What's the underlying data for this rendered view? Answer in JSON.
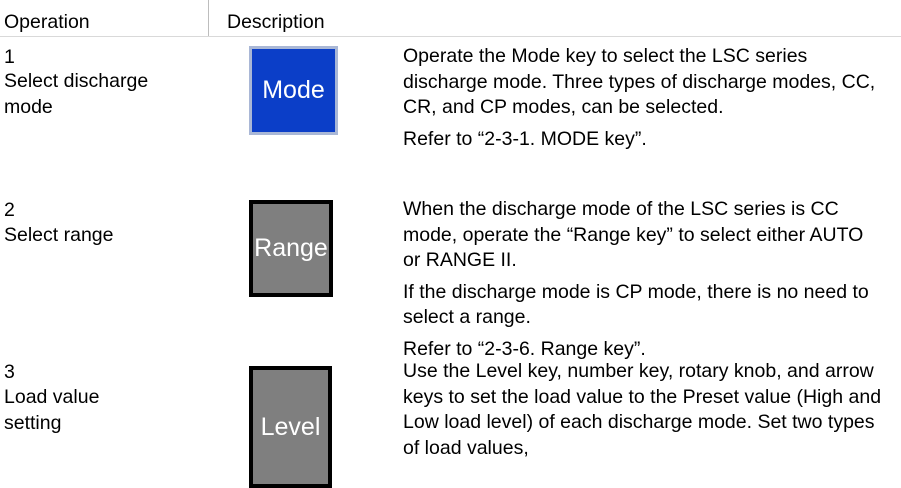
{
  "header": {
    "operation": "Operation",
    "description": "Description"
  },
  "steps": [
    {
      "number": "1",
      "label": "Select discharge mode",
      "key_label": "Mode",
      "paragraphs": [
        "Operate the Mode key to select the LSC series discharge mode. Three types of discharge modes, CC, CR, and CP modes, can be selected.",
        "Refer to “2-3-1. MODE key”."
      ]
    },
    {
      "number": "2",
      "label": "Select range",
      "key_label": "Range",
      "paragraphs": [
        "When the discharge mode of the LSC series is CC mode, operate the “Range key” to select either AUTO or RANGE II.",
        "If the discharge mode is CP mode, there is no need to select a range.",
        "Refer to “2-3-6. Range key”."
      ]
    },
    {
      "number": "3",
      "label": "Load value setting",
      "key_label": "Level",
      "paragraphs": [
        "Use the Level key, number key, rotary knob, and arrow keys to set the load value to the Preset value (High and Low load level) of each discharge mode. Set two types of load values,"
      ]
    }
  ],
  "colors": {
    "mode_key": "#0b3ec8",
    "gray_key": "#7f7f7f"
  }
}
